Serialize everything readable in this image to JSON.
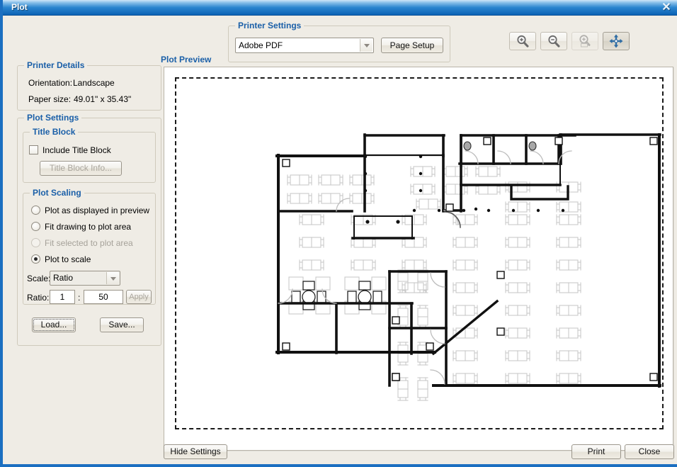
{
  "window": {
    "title": "Plot",
    "close_icon": "close-icon",
    "close_glyph": "✕"
  },
  "toolbar": {
    "buttons": [
      {
        "name": "zoom-in-button",
        "icon": "magnifier-plus-icon",
        "state": "enabled"
      },
      {
        "name": "zoom-out-button",
        "icon": "magnifier-minus-icon",
        "state": "enabled"
      },
      {
        "name": "zoom-extents-button",
        "icon": "magnifier-window-icon",
        "state": "disabled"
      },
      {
        "name": "pan-button",
        "icon": "pan-arrows-icon",
        "state": "active"
      }
    ]
  },
  "printer_settings": {
    "legend": "Printer Settings",
    "printer_value": "Adobe PDF",
    "printer_options": [
      "Adobe PDF"
    ],
    "page_setup_label": "Page Setup"
  },
  "printer_details": {
    "legend": "Printer Details",
    "orientation_label": "Orientation:",
    "orientation_value": "Landscape",
    "paper_size_label": "Paper size:",
    "paper_size_value": "49.01\" x 35.43\""
  },
  "plot_settings": {
    "legend": "Plot Settings",
    "title_block": {
      "legend": "Title Block",
      "include_label": "Include Title Block",
      "include_checked": false,
      "info_button_label": "Title Block Info...",
      "info_button_enabled": false
    },
    "plot_scaling": {
      "legend": "Plot Scaling",
      "options": [
        {
          "label": "Plot as displayed in preview",
          "selected": false,
          "enabled": true
        },
        {
          "label": "Fit drawing to plot area",
          "selected": false,
          "enabled": true
        },
        {
          "label": "Fit selected to plot area",
          "selected": false,
          "enabled": false
        },
        {
          "label": "Plot to scale",
          "selected": true,
          "enabled": true
        }
      ],
      "scale_label": "Scale:",
      "scale_value": "Ratio",
      "scale_options": [
        "Ratio"
      ],
      "ratio_label": "Ratio:",
      "ratio_numerator": "1",
      "ratio_separator": ":",
      "ratio_denominator": "50",
      "apply_label": "Apply",
      "apply_enabled": false
    },
    "load_label": "Load...",
    "save_label": "Save..."
  },
  "preview": {
    "label": "Plot Preview",
    "drawing_description": "architectural floor plan"
  },
  "footer": {
    "hide_settings_label": "Hide Settings",
    "print_label": "Print",
    "close_label": "Close"
  },
  "colors": {
    "accent": "#1b6fc1",
    "group_header": "#1a5fa8",
    "surface": "#efece5",
    "paper": "#ffffff",
    "wall": "#000000",
    "furniture": "#c8c8c8"
  }
}
